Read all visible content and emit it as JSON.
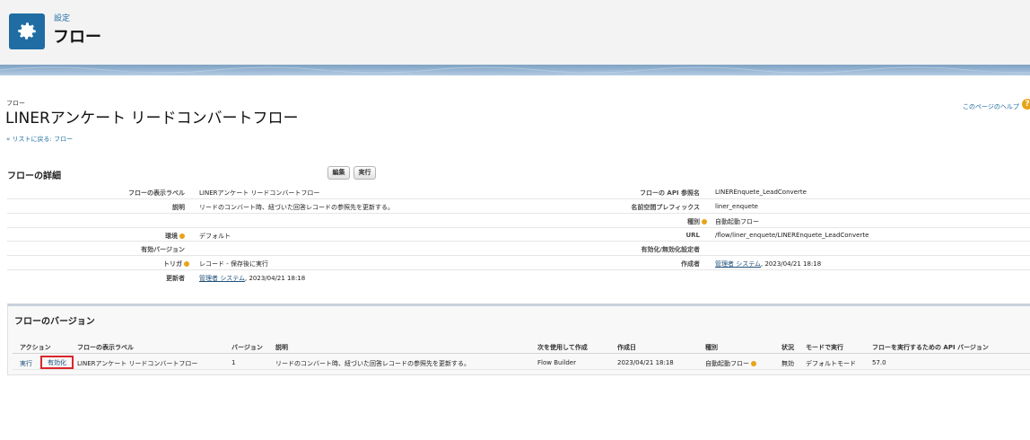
{
  "header": {
    "breadcrumb": "設定",
    "title": "フロー"
  },
  "object": {
    "label": "フロー",
    "title": "LINERアンケート リードコンバートフロー",
    "back_link": "« リストに戻る: フロー",
    "help_link": "このページのヘルプ"
  },
  "detail": {
    "heading": "フローの詳細",
    "edit_button": "編集",
    "run_button": "実行",
    "left": [
      {
        "label": "フローの表示ラベル",
        "value": "LINERアンケート リードコンバートフロー"
      },
      {
        "label": "説明",
        "value": "リードのコンバート時、紐づいた回答レコードの参照先を更新する。"
      },
      {
        "label": "",
        "value": ""
      },
      {
        "label": "環境",
        "value": "デフォルト"
      },
      {
        "label": "有効バージョン",
        "value": ""
      },
      {
        "label": "トリガ",
        "value": "レコード - 保存後に実行"
      },
      {
        "label": "更新者",
        "value": "管理者 システム",
        "suffix": ", 2023/04/21 18:18"
      }
    ],
    "right": [
      {
        "label": "フローの API 参照名",
        "value": "LINEREnquete_LeadConverte"
      },
      {
        "label": "名前空間プレフィックス",
        "value": "liner_enquete"
      },
      {
        "label": "種別",
        "value": "自動起動フロー"
      },
      {
        "label": "URL",
        "value": "/flow/liner_enquete/LINEREnquete_LeadConverte"
      },
      {
        "label": "有効化/無効化設定者",
        "value": ""
      },
      {
        "label": "作成者",
        "value": "管理者 システム",
        "suffix": ", 2023/04/21 18:18"
      }
    ]
  },
  "versions": {
    "heading": "フローのバージョン",
    "columns": [
      "アクション",
      "フローの表示ラベル",
      "バージョン",
      "説明",
      "次を使用して作成",
      "作成日",
      "種別",
      "状況",
      "モードで実行",
      "フローを実行するための API バージョン"
    ],
    "row": {
      "action_run": "実行",
      "action_activate": "有効化",
      "label": "LINERアンケート リードコンバートフロー",
      "version": "1",
      "description": "リードのコンバート時、紐づいた回答レコードの参照先を更新する。",
      "built_with": "Flow Builder",
      "created": "2023/04/21 18:18",
      "type": "自動起動フロー",
      "status": "無効",
      "run_mode": "デフォルトモード",
      "api_version": "57.0"
    }
  },
  "colors": {
    "accent": "#1f6da3",
    "highlight": "#d9262c",
    "info": "#e8a317"
  },
  "icons": {
    "app": "gear-icon",
    "help": "help-icon",
    "info": "info-icon"
  }
}
